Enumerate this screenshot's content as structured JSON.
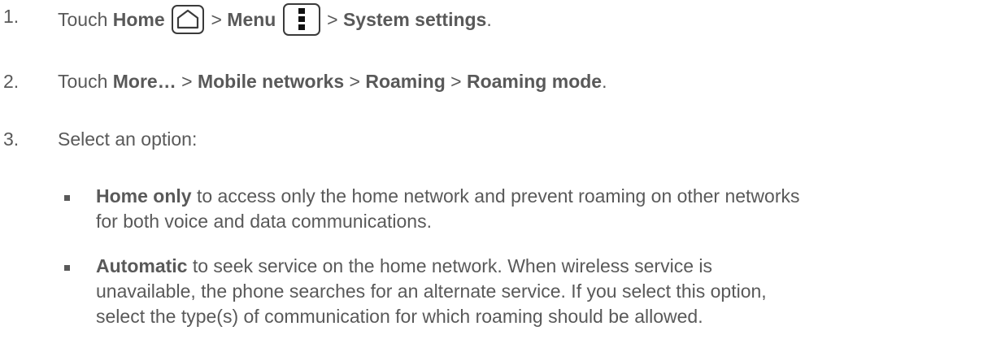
{
  "steps": [
    {
      "number": "1.",
      "prefix": "Touch",
      "home_label": "Home",
      "sep1": ">",
      "menu_label": "Menu",
      "sep2": ">",
      "settings_label": "System settings",
      "end": "."
    },
    {
      "number": "2.",
      "prefix": "Touch",
      "more_label": "More…",
      "sep1": ">",
      "mobile_label": "Mobile networks",
      "sep2": ">",
      "roaming_label": "Roaming",
      "sep3": ">",
      "mode_label": "Roaming mode",
      "end": "."
    },
    {
      "number": "3.",
      "text": "Select an option:"
    }
  ],
  "options": [
    {
      "title": "Home only",
      "line1": " to access only the home network and prevent roaming on other networks",
      "line2": "for both voice and data communications."
    },
    {
      "title": "Automatic",
      "line1": " to seek service on the home network. When wireless service is",
      "line2": "unavailable, the phone searches for an alternate service. If you select this option,",
      "line3": "select the type(s) of communication for which roaming should be allowed."
    }
  ],
  "icons": {
    "home": "home-icon",
    "menu": "overflow-menu-icon"
  },
  "colors": {
    "text": "#595959",
    "icon_stroke": "#3a3a3a"
  }
}
